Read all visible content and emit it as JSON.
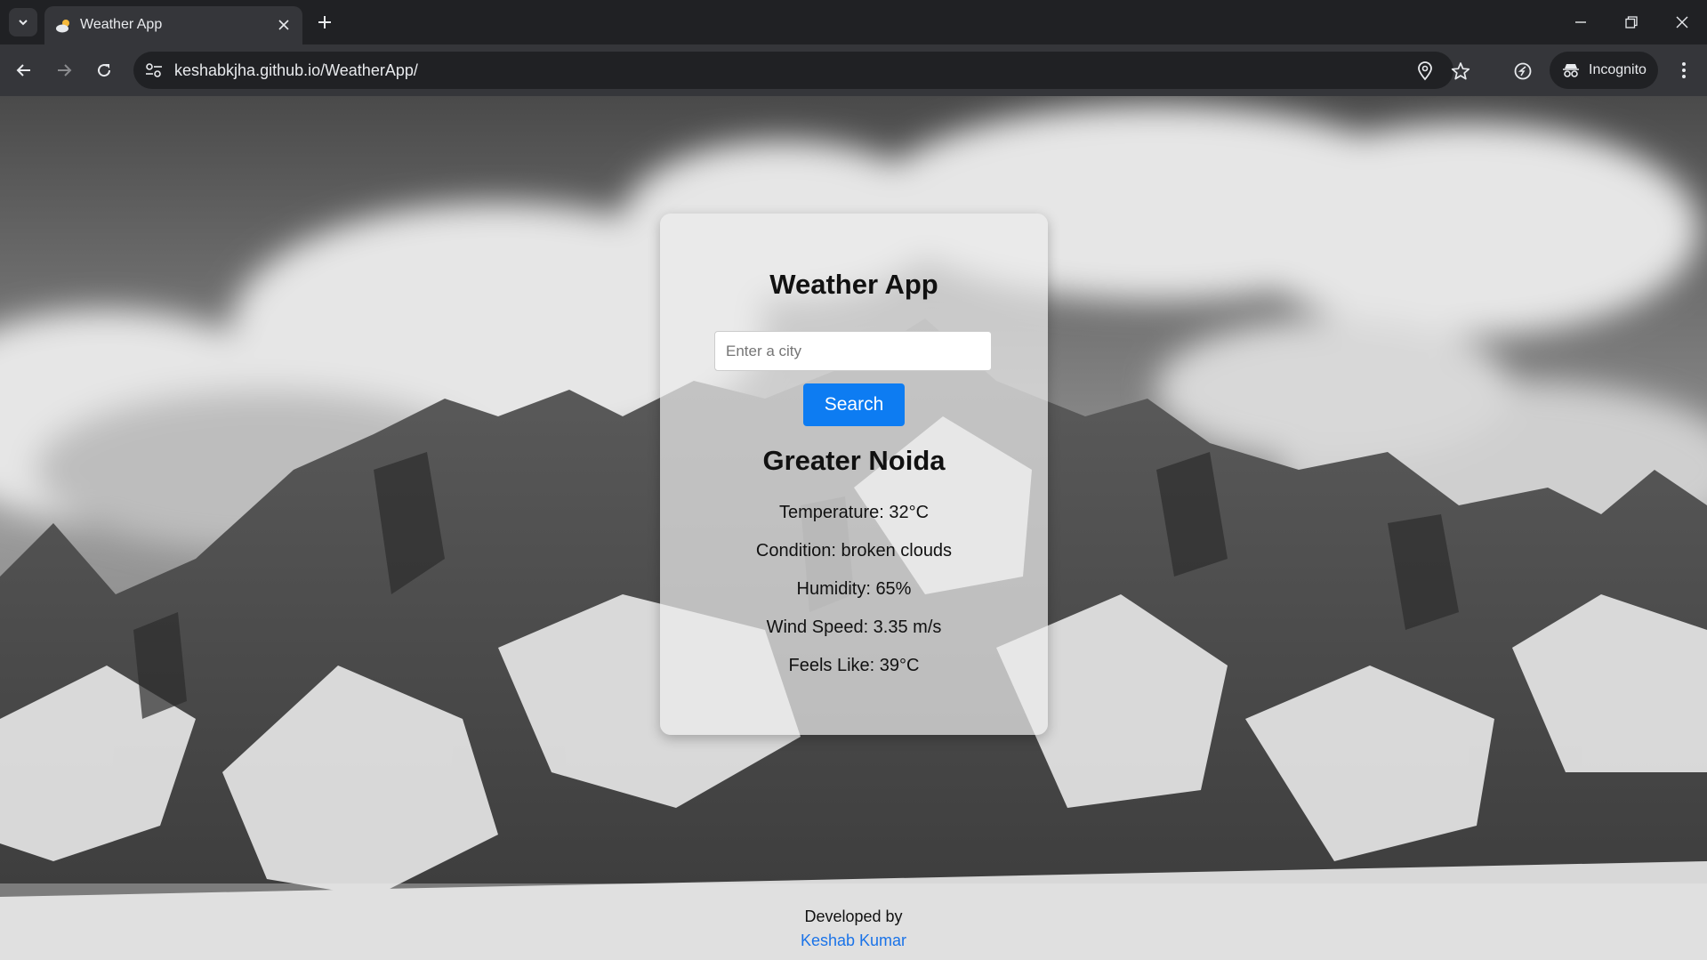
{
  "browser": {
    "tab": {
      "title": "Weather App",
      "favicon": "weather-cloud-sun-icon"
    },
    "address": {
      "url": "keshabkjha.github.io/WeatherApp/"
    },
    "incognito_label": "Incognito"
  },
  "app": {
    "title": "Weather App",
    "search": {
      "placeholder": "Enter a city",
      "value": "",
      "button_label": "Search"
    },
    "weather": {
      "city": "Greater Noida",
      "temperature": "Temperature: 32°C",
      "condition": "Condition: broken clouds",
      "humidity": "Humidity: 65%",
      "wind": "Wind Speed: 3.35 m/s",
      "feels_like": "Feels Like: 39°C"
    },
    "footer": {
      "developed_by": "Developed by",
      "author": "Keshab Kumar"
    }
  },
  "colors": {
    "accent": "#0d7cf2",
    "link": "#1a73e8",
    "chrome_dark": "#202124",
    "chrome_mid": "#35363a"
  }
}
